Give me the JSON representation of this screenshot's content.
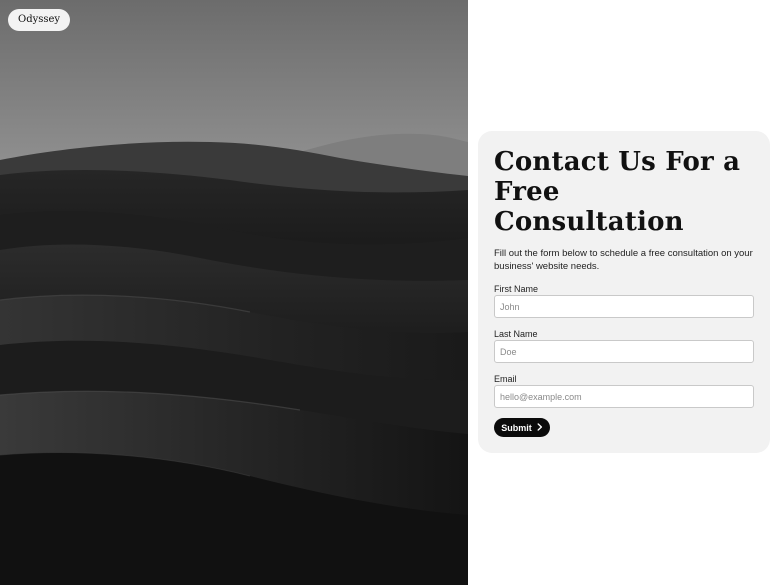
{
  "brand": {
    "name": "Odyssey"
  },
  "form": {
    "title": "Contact Us For a Free Consultation",
    "subtitle": "Fill out the form below to schedule a free consultation on your business' website needs.",
    "fields": [
      {
        "label": "First Name",
        "placeholder": "John",
        "value": ""
      },
      {
        "label": "Last Name",
        "placeholder": "Doe",
        "value": ""
      },
      {
        "label": "Email",
        "placeholder": "hello@example.com",
        "value": ""
      }
    ],
    "submit_label": "Submit",
    "submit_icon": "chevron-right-icon"
  },
  "colors": {
    "card_background": "#f2f2f2",
    "button_background": "#0b0b0b",
    "button_text": "#ffffff"
  }
}
